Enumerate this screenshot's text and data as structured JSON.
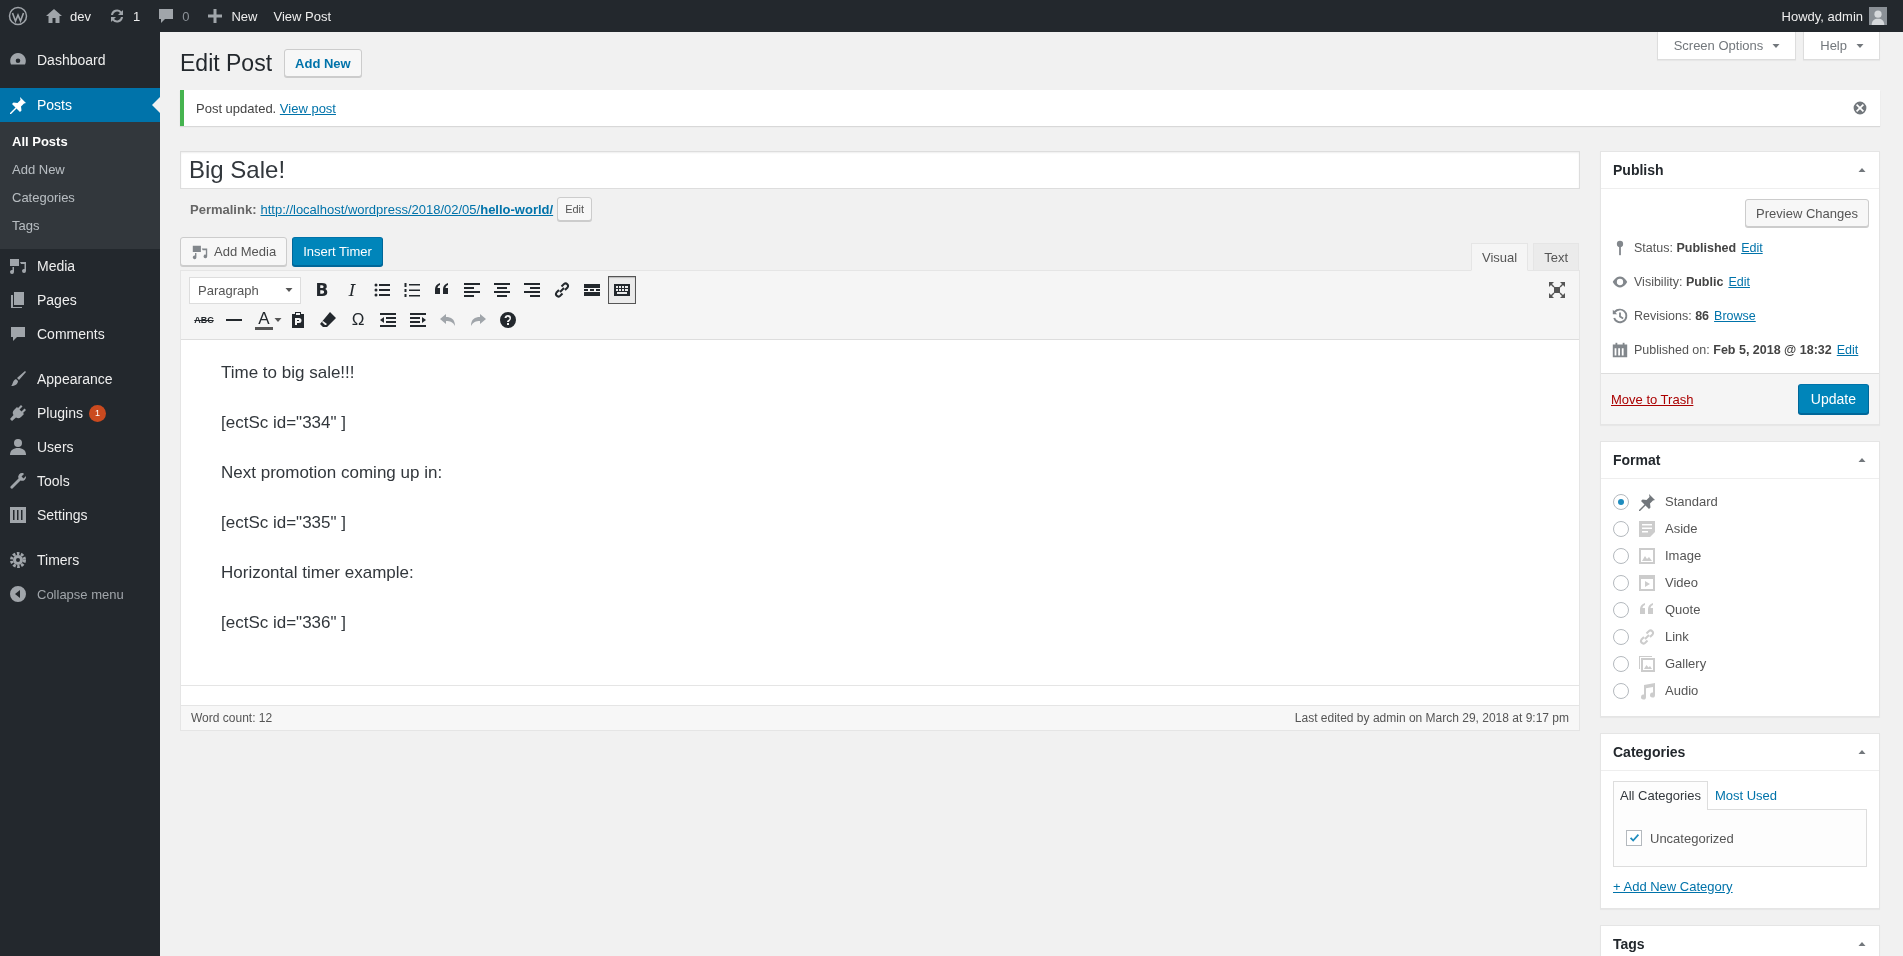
{
  "admin_bar": {
    "items": [
      {
        "kind": "logo"
      },
      {
        "kind": "site",
        "label": "dev"
      },
      {
        "kind": "updates",
        "label": "1"
      },
      {
        "kind": "comments",
        "label": "0"
      },
      {
        "kind": "new",
        "label": "New"
      },
      {
        "kind": "link",
        "label": "View Post"
      }
    ],
    "account": "Howdy, admin"
  },
  "sidebar": {
    "items": [
      {
        "kind": "menu",
        "label": "Dashboard",
        "selected": false
      },
      {
        "kind": "separator"
      },
      {
        "kind": "menu",
        "label": "Posts",
        "selected": true,
        "children": [
          {
            "label": "All Posts",
            "selected": true
          },
          {
            "label": "Add New",
            "selected": false
          },
          {
            "label": "Categories",
            "selected": false
          },
          {
            "label": "Tags",
            "selected": false
          }
        ]
      },
      {
        "kind": "menu",
        "label": "Media",
        "selected": false
      },
      {
        "kind": "menu",
        "label": "Pages",
        "selected": false
      },
      {
        "kind": "menu",
        "label": "Comments",
        "selected": false
      },
      {
        "kind": "separator"
      },
      {
        "kind": "menu",
        "label": "Appearance",
        "selected": false
      },
      {
        "kind": "menu",
        "label": "Plugins",
        "selected": false,
        "badge": "1"
      },
      {
        "kind": "menu",
        "label": "Users",
        "selected": false
      },
      {
        "kind": "menu",
        "label": "Tools",
        "selected": false
      },
      {
        "kind": "menu",
        "label": "Settings",
        "selected": false
      },
      {
        "kind": "separator"
      },
      {
        "kind": "menu",
        "label": "Timers",
        "selected": false
      }
    ],
    "collapse": "Collapse menu"
  },
  "header": {
    "title": "Edit Post",
    "add_new": "Add New",
    "screen_options": "Screen Options",
    "help": "Help"
  },
  "notice": {
    "text": "Post updated.",
    "link": "View post"
  },
  "post": {
    "title": "Big Sale!",
    "permalink_label": "Permalink:",
    "permalink": "http://localhost/wordpress/2018/02/05/**hello-world/**",
    "permalink_edit": "Edit"
  },
  "editor": {
    "media_buttons": [
      "Add Media",
      "Insert Timer"
    ],
    "tabs": [
      {
        "label": "Visual",
        "selected": true
      },
      {
        "label": "Text",
        "selected": false
      }
    ],
    "toolbar_rows": [
      [
        {
          "kind": "select",
          "label": "Paragraph",
          "pressed": false,
          "disabled": false
        },
        {
          "kind": "bold",
          "label": "B",
          "pressed": false,
          "disabled": false
        },
        {
          "kind": "italic",
          "label": "I",
          "pressed": false,
          "disabled": false
        },
        {
          "kind": "bullets",
          "pressed": false,
          "disabled": false
        },
        {
          "kind": "numbers",
          "pressed": false,
          "disabled": false
        },
        {
          "kind": "quote",
          "pressed": false,
          "disabled": false
        },
        {
          "kind": "alignleft",
          "pressed": false,
          "disabled": false
        },
        {
          "kind": "aligncenter",
          "pressed": false,
          "disabled": false
        },
        {
          "kind": "alignright",
          "pressed": false,
          "disabled": false
        },
        {
          "kind": "link",
          "pressed": false,
          "disabled": false
        },
        {
          "kind": "more",
          "pressed": false,
          "disabled": false
        },
        {
          "kind": "toggle",
          "pressed": true,
          "disabled": false
        }
      ],
      [
        {
          "kind": "strike",
          "label": "ABC",
          "pressed": false,
          "disabled": false
        },
        {
          "kind": "hr",
          "pressed": false,
          "disabled": false
        },
        {
          "kind": "color",
          "label": "A",
          "pressed": false,
          "disabled": false
        },
        {
          "kind": "paste",
          "pressed": false,
          "disabled": false
        },
        {
          "kind": "eraser",
          "pressed": false,
          "disabled": false
        },
        {
          "kind": "omega",
          "label": "Ω",
          "pressed": false,
          "disabled": false
        },
        {
          "kind": "outdent",
          "pressed": false,
          "disabled": false
        },
        {
          "kind": "indent",
          "pressed": false,
          "disabled": false
        },
        {
          "kind": "undo",
          "pressed": false,
          "disabled": true
        },
        {
          "kind": "redo",
          "pressed": false,
          "disabled": true
        },
        {
          "kind": "help",
          "pressed": false,
          "disabled": false
        }
      ]
    ],
    "paragraphs": [
      "Time to big sale!!!",
      "[ectSc id=\"334\" ]",
      "Next promotion coming up in:",
      "[ectSc id=\"335\" ]",
      "Horizontal timer example:",
      "[ectSc id=\"336\" ]"
    ],
    "word_count": "Word count: 12",
    "last_edited": "Last edited by admin on March 29, 2018 at 9:17 pm"
  },
  "publish": {
    "title": "Publish",
    "preview": "Preview Changes",
    "rows": [
      {
        "label": "Status:",
        "value": "Published",
        "link": "Edit"
      },
      {
        "label": "Visibility:",
        "value": "Public",
        "link": "Edit"
      },
      {
        "label": "Revisions:",
        "value": "86",
        "link": "Browse"
      },
      {
        "label": "Published on:",
        "value": "Feb 5, 2018 @ 18:32",
        "link": "Edit"
      }
    ],
    "trash": "Move to Trash",
    "update": "Update"
  },
  "format": {
    "title": "Format",
    "options": [
      {
        "label": "Standard",
        "selected": true
      },
      {
        "label": "Aside",
        "selected": false
      },
      {
        "label": "Image",
        "selected": false
      },
      {
        "label": "Video",
        "selected": false
      },
      {
        "label": "Quote",
        "selected": false
      },
      {
        "label": "Link",
        "selected": false
      },
      {
        "label": "Gallery",
        "selected": false
      },
      {
        "label": "Audio",
        "selected": false
      }
    ]
  },
  "categories": {
    "title": "Categories",
    "tabs": [
      {
        "label": "All Categories",
        "selected": true
      },
      {
        "label": "Most Used",
        "selected": false
      }
    ],
    "items": [
      {
        "label": "Uncategorized",
        "checked": true
      }
    ],
    "add_link": "+ Add New Category"
  },
  "tags": {
    "title": "Tags"
  }
}
